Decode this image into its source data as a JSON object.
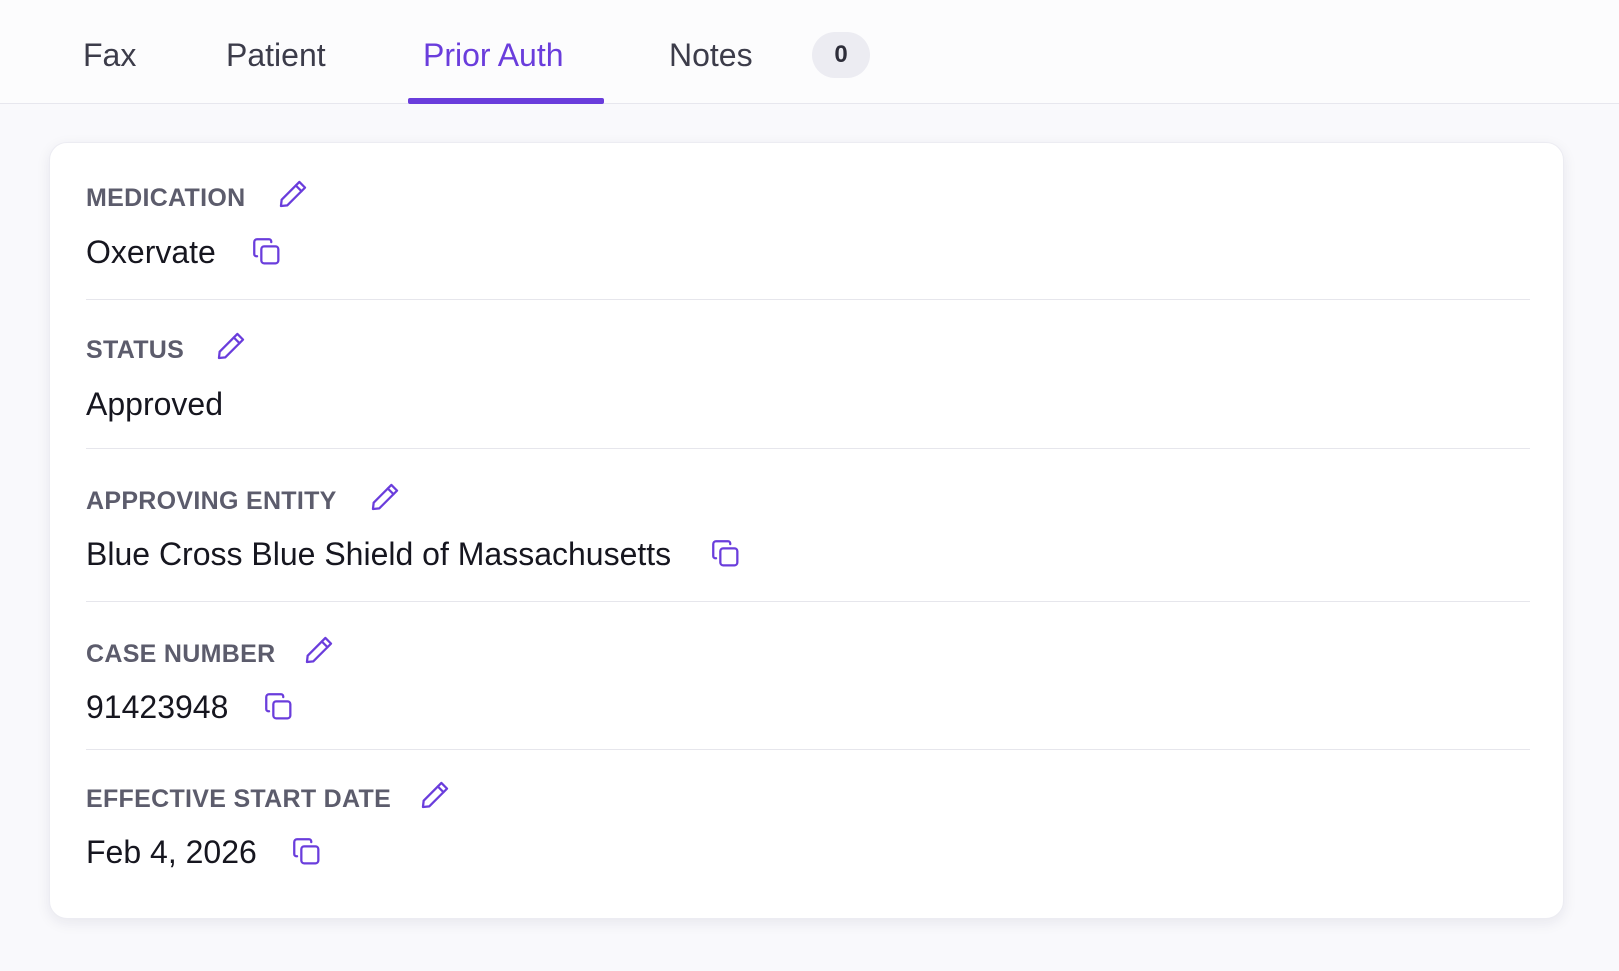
{
  "tabs": [
    {
      "label": "Fax"
    },
    {
      "label": "Patient"
    },
    {
      "label": "Prior Auth",
      "active": true
    },
    {
      "label": "Notes"
    }
  ],
  "notes_count": "0",
  "fields": [
    {
      "label": "MEDICATION",
      "value": "Oxervate",
      "edit_icon": "pencil-icon",
      "copy_icon": "copy-icon"
    },
    {
      "label": "STATUS",
      "value": "Approved",
      "edit_icon": "pencil-icon"
    },
    {
      "label": "APPROVING ENTITY",
      "value": "Blue Cross Blue Shield of Massachusetts",
      "edit_icon": "pencil-icon",
      "copy_icon": "copy-icon"
    },
    {
      "label": "CASE NUMBER",
      "value": "91423948",
      "edit_icon": "pencil-icon",
      "copy_icon": "copy-icon"
    },
    {
      "label": "EFFECTIVE START DATE",
      "value": "Feb 4, 2026",
      "edit_icon": "pencil-icon",
      "copy_icon": "copy-icon"
    }
  ],
  "colors": {
    "accent": "#6a3ddc",
    "label": "#5c5c6c",
    "value": "#16161f",
    "tab_inactive": "#3c3c4a",
    "page_bg": "#f9f9fc"
  }
}
